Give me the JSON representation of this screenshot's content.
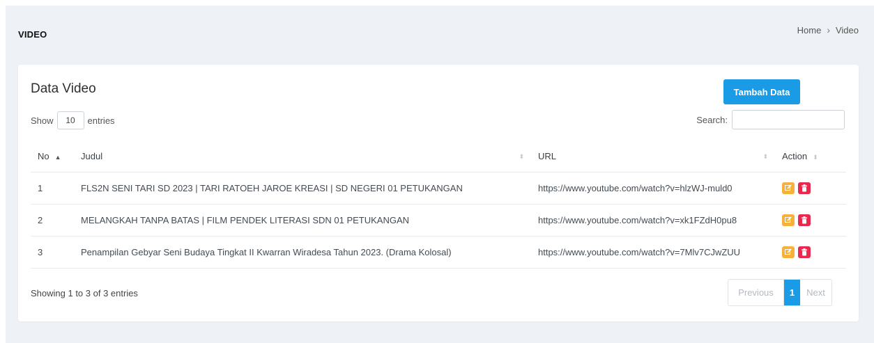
{
  "header": {
    "title": "VIDEO",
    "breadcrumb": {
      "home": "Home",
      "separator": "›",
      "current": "Video"
    }
  },
  "card": {
    "title": "Data Video",
    "add_button": "Tambah Data",
    "show_label": "Show",
    "entries_value": "10",
    "entries_label": "entries",
    "search_label": "Search:",
    "search_value": ""
  },
  "table": {
    "headers": {
      "no": "No",
      "judul": "Judul",
      "url": "URL",
      "action": "Action"
    },
    "rows": [
      {
        "no": "1",
        "judul": "FLS2N SENI TARI SD 2023 | TARI RATOEH JAROE KREASI | SD NEGERI 01 PETUKANGAN",
        "url": "https://www.youtube.com/watch?v=hlzWJ-muld0"
      },
      {
        "no": "2",
        "judul": "MELANGKAH TANPA BATAS | FILM PENDEK LITERASI SDN 01 PETUKANGAN",
        "url": "https://www.youtube.com/watch?v=xk1FZdH0pu8"
      },
      {
        "no": "3",
        "judul": "Penampilan Gebyar Seni Budaya Tingkat II Kwarran Wiradesa Tahun 2023. (Drama Kolosal)",
        "url": "https://www.youtube.com/watch?v=7Mlv7CJwZUU"
      }
    ]
  },
  "footer": {
    "info": "Showing 1 to 3 of 3 entries",
    "pagination": {
      "previous": "Previous",
      "current": "1",
      "next": "Next"
    }
  },
  "colors": {
    "primary": "#1a9be6",
    "edit": "#f6b13a",
    "delete": "#e8284d"
  },
  "icons": {
    "edit": "edit-icon",
    "delete": "trash-icon"
  }
}
